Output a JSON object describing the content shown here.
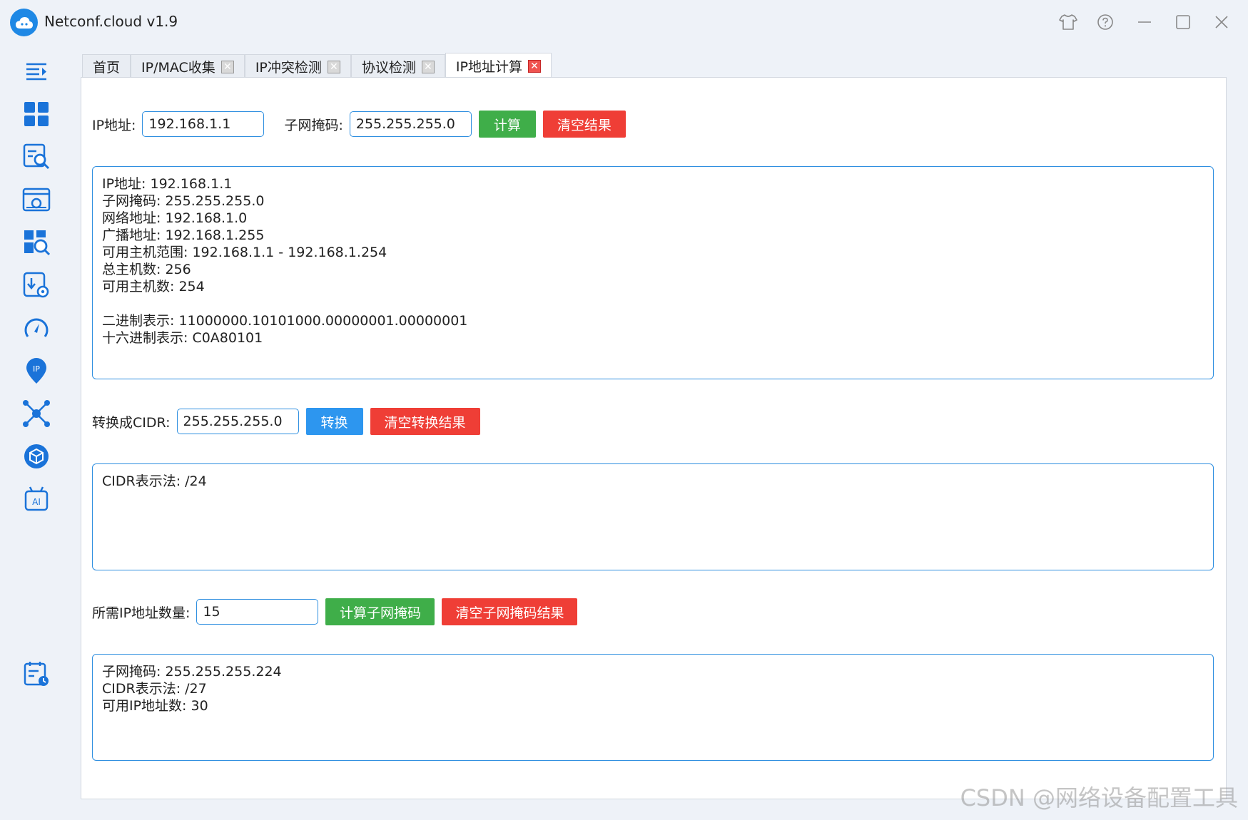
{
  "app": {
    "title": "Netconf.cloud v1.9"
  },
  "titlebar": {
    "controls": [
      "shirt-icon",
      "help-icon",
      "minimize-icon",
      "maximize-icon",
      "close-icon"
    ]
  },
  "sidebar": {
    "items": [
      "menu-toggle-icon",
      "dashboard-icon",
      "search-document-icon",
      "config-window-icon",
      "search-grid-icon",
      "download-settings-icon",
      "speed-gauge-icon",
      "ip-location-icon",
      "network-topology-icon",
      "cube-icon",
      "ai-robot-icon",
      "calendar-clock-icon"
    ]
  },
  "tabs": [
    {
      "label": "首页",
      "closable": false,
      "active": false
    },
    {
      "label": "IP/MAC收集",
      "closable": true,
      "active": false
    },
    {
      "label": "IP冲突检测",
      "closable": true,
      "active": false
    },
    {
      "label": "协议检测",
      "closable": true,
      "active": false
    },
    {
      "label": "IP地址计算",
      "closable": true,
      "active": true
    }
  ],
  "tab_close_glyph": "✕",
  "calc": {
    "ip_label": "IP地址:",
    "ip_value": "192.168.1.1",
    "mask_label": "子网掩码:",
    "mask_value": "255.255.255.0",
    "calc_button": "计算",
    "clear_button": "清空结果",
    "result_lines": [
      "IP地址: 192.168.1.1",
      "子网掩码: 255.255.255.0",
      "网络地址: 192.168.1.0",
      "广播地址: 192.168.1.255",
      "可用主机范围: 192.168.1.1 - 192.168.1.254",
      "总主机数: 256",
      "可用主机数: 254",
      "",
      "二进制表示: 11000000.10101000.00000001.00000001",
      "十六进制表示: C0A80101"
    ]
  },
  "cidr": {
    "label": "转换成CIDR:",
    "value": "255.255.255.0",
    "convert_button": "转换",
    "clear_button": "清空转换结果",
    "result_lines": [
      "CIDR表示法: /24"
    ]
  },
  "subnet": {
    "label": "所需IP地址数量:",
    "value": "15",
    "calc_button": "计算子网掩码",
    "clear_button": "清空子网掩码结果",
    "result_lines": [
      "子网掩码: 255.255.255.224",
      "CIDR表示法: /27",
      "可用IP地址数: 30"
    ]
  },
  "watermark": "CSDN @网络设备配置工具",
  "colors": {
    "accent_blue": "#2d96ef",
    "green": "#3fae49",
    "red": "#ef3e36",
    "logo": "#1e88e5",
    "icon_blue": "#1a73d9"
  }
}
